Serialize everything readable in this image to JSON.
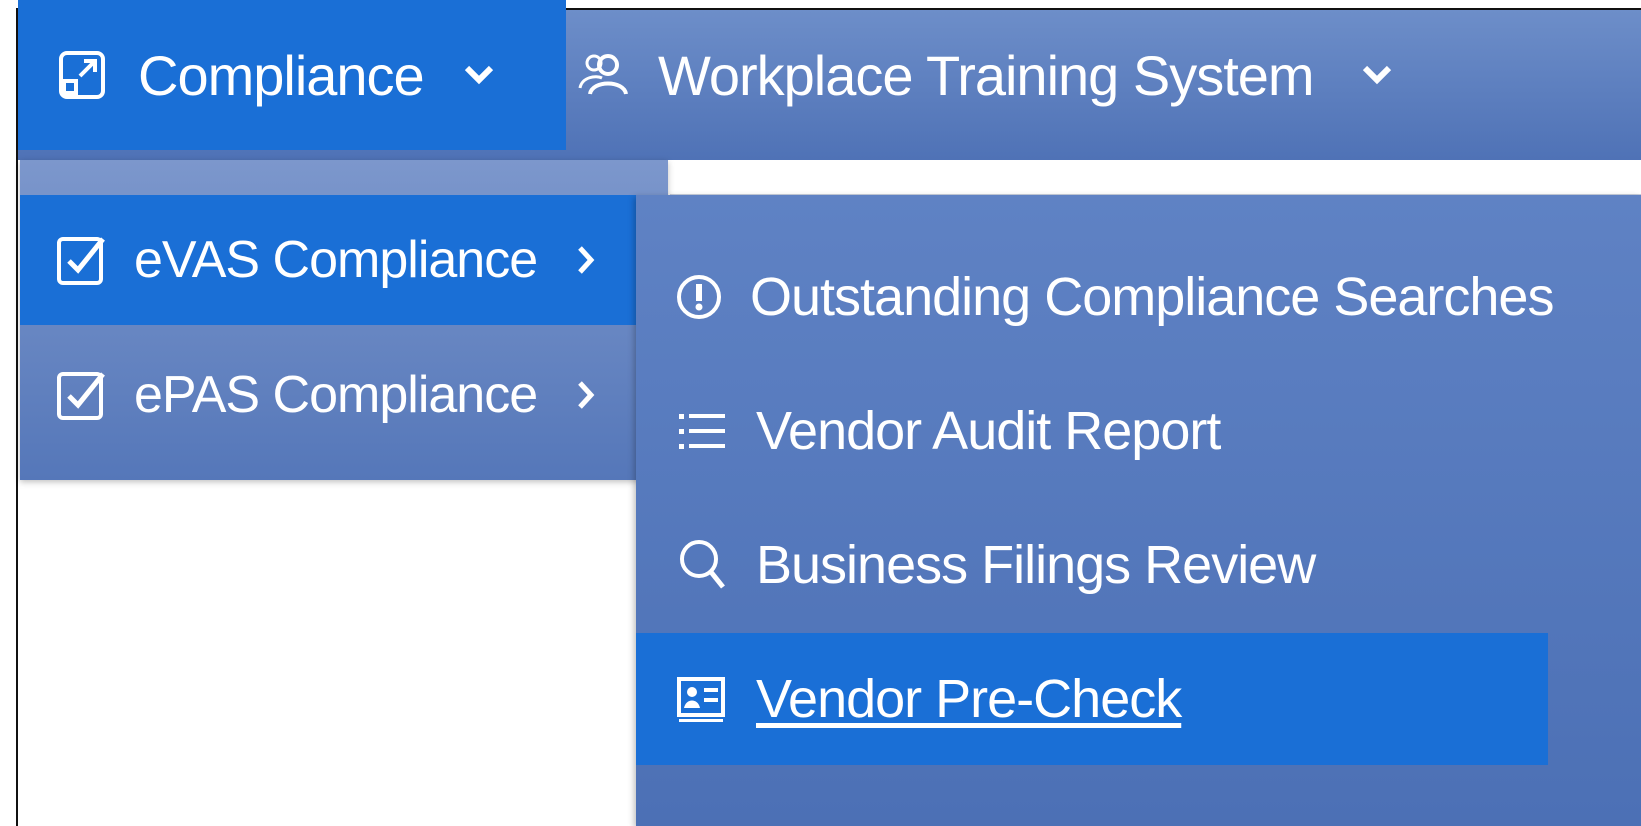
{
  "nav": {
    "items": [
      {
        "label": "Compliance",
        "icon": "external-link-box-icon"
      },
      {
        "label": "Workplace Training System",
        "icon": "users-icon"
      }
    ]
  },
  "menu": {
    "items": [
      {
        "label": "eVAS Compliance",
        "icon": "checkbox-icon"
      },
      {
        "label": "ePAS Compliance",
        "icon": "checkbox-icon"
      }
    ]
  },
  "submenu": {
    "items": [
      {
        "label": "Outstanding Compliance Searches",
        "icon": "alert-circle-icon"
      },
      {
        "label": "Vendor Audit Report",
        "icon": "list-icon"
      },
      {
        "label": "Business Filings Review",
        "icon": "search-icon"
      },
      {
        "label": "Vendor Pre-Check",
        "icon": "id-card-icon"
      }
    ]
  },
  "colors": {
    "active": "#1a6fd6",
    "bar": "#5a7cbc",
    "text": "#ffffff"
  }
}
